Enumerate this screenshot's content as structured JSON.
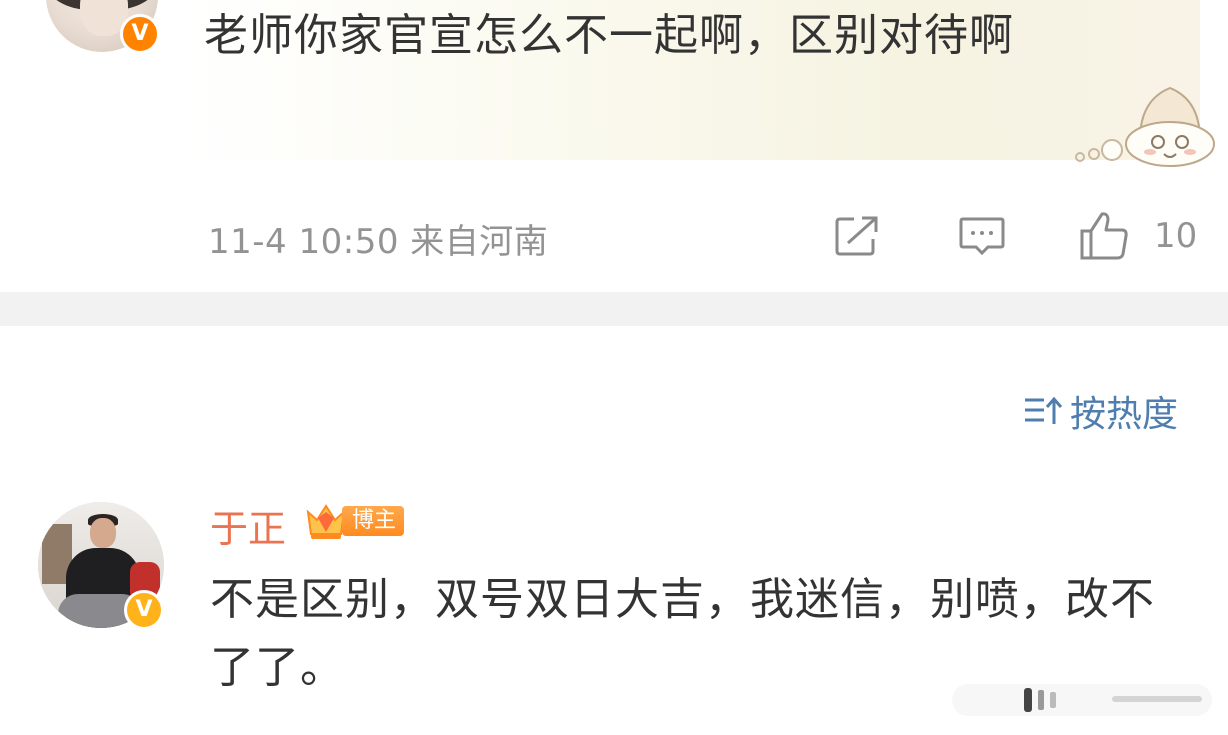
{
  "top_comment": {
    "text": "老师你家官宣怎么不一起啊，区别对待啊",
    "meta": "11-4 10:50 来自河南",
    "like_count": "10",
    "verified_badge": "V"
  },
  "sort": {
    "label": "按热度"
  },
  "reply": {
    "username": "于正",
    "role_badge": "博主",
    "text": "不是区别，双号双日大吉，我迷信，别喷，改不了了。",
    "verified_badge": "V"
  },
  "icons": [
    "avatar",
    "verified-badge",
    "share-icon",
    "comment-icon",
    "like-icon",
    "sort-icon",
    "crown-icon",
    "mascot-sticker"
  ],
  "colors": {
    "username": "#eb7350",
    "link_blue": "#507daf",
    "meta_gray": "#939393",
    "badge_orange": "#ff8200",
    "separator": "#f2f2f2"
  }
}
